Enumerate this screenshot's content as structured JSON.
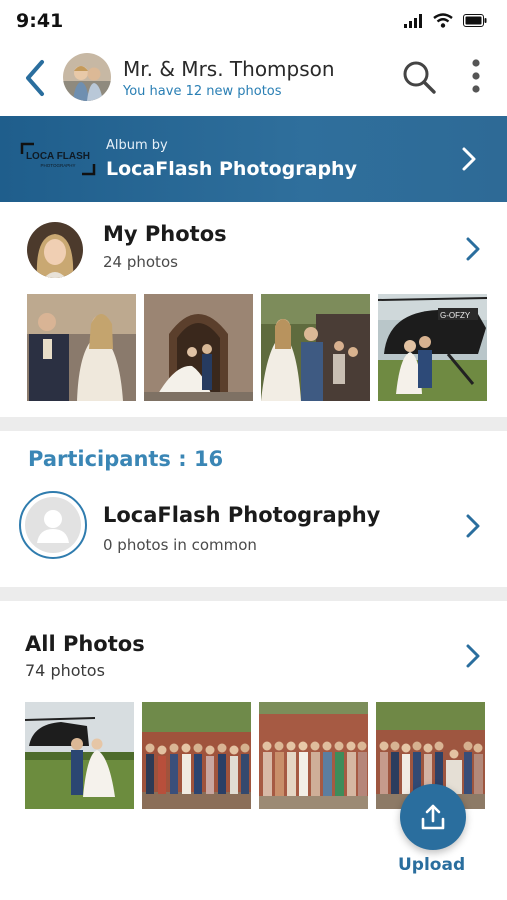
{
  "status_bar": {
    "time": "9:41"
  },
  "header": {
    "title": "Mr. & Mrs. Thompson",
    "subtitle": "You have 12 new photos"
  },
  "album_banner": {
    "prefix": "Album by",
    "name": "LocaFlash Photography",
    "logo_text": "LOCA FLASH",
    "logo_subtext": "PHOTOGRAPHY"
  },
  "my_photos": {
    "title": "My Photos",
    "count_label": "24 photos"
  },
  "participants": {
    "title": "Participants : 16",
    "items": [
      {
        "name": "LocaFlash Photography",
        "common_label": "0 photos in common"
      }
    ]
  },
  "all_photos": {
    "title": "All Photos",
    "count_label": "74 photos"
  },
  "upload": {
    "label": "Upload"
  },
  "colors": {
    "accent": "#2a6e9e",
    "accent_light": "#3a86b5",
    "banner": "#2a6a96",
    "divider": "#ececec"
  },
  "icons": [
    "back-arrow-icon",
    "search-icon",
    "more-vertical-icon",
    "chevron-right-icon",
    "upload-icon",
    "user-placeholder-icon"
  ]
}
